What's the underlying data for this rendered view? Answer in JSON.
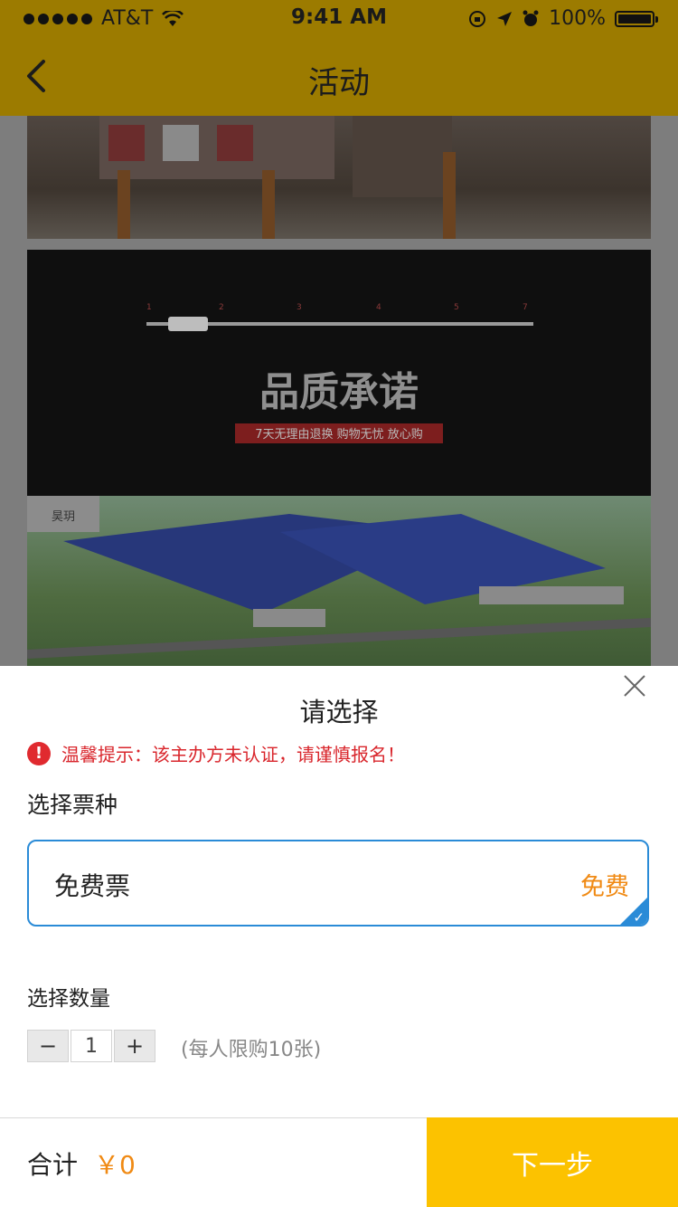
{
  "status_bar": {
    "carrier": "AT&T",
    "time": "9:41 AM",
    "battery": "100%"
  },
  "nav": {
    "title": "活动"
  },
  "background_banner": {
    "headline": "品质承诺",
    "subline": "7天无理由退换 购物无忧 放心购",
    "scale_labels": [
      "1",
      "2",
      "3",
      "4",
      "5",
      "7"
    ],
    "logo_text": "昊玥"
  },
  "sheet": {
    "title": "请选择",
    "warning": "温馨提示：该主办方未认证，请谨慎报名！",
    "ticket_section_label": "选择票种",
    "ticket": {
      "name": "免费票",
      "price": "免费"
    },
    "quantity_section_label": "选择数量",
    "quantity": {
      "minus": "−",
      "value": "1",
      "plus": "+"
    },
    "limit_note": "(每人限购10张)"
  },
  "footer": {
    "total_label": "合计",
    "total_amount": "￥0",
    "next_label": "下一步"
  },
  "colors": {
    "nav_bar": "#9c7b00",
    "accent_orange": "#f08a14",
    "warning_red": "#e02a2f",
    "ticket_border": "#2a8bd7",
    "next_button": "#fcc200"
  }
}
